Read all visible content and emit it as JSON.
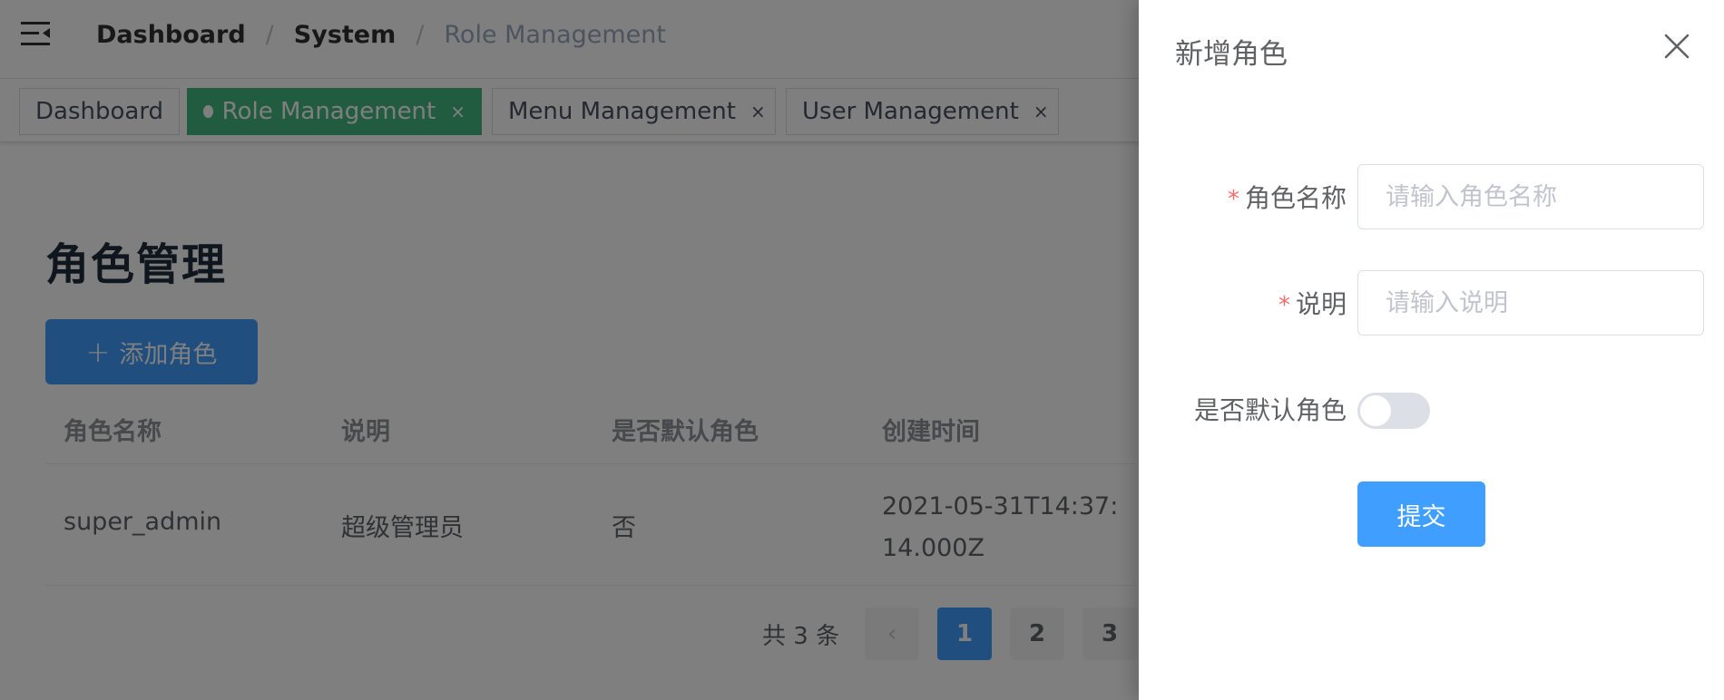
{
  "navbar": {
    "breadcrumb": [
      "Dashboard",
      "System",
      "Role Management"
    ],
    "separator": "/"
  },
  "tags": [
    {
      "label": "Dashboard",
      "active": false,
      "closable": false
    },
    {
      "label": "Role Management",
      "active": true,
      "closable": true
    },
    {
      "label": "Menu Management",
      "active": false,
      "closable": true
    },
    {
      "label": "User Management",
      "active": false,
      "closable": true
    }
  ],
  "tag_close_glyph": "×",
  "page": {
    "title": "角色管理",
    "add_button_label": "添加角色",
    "add_button_icon": "plus-icon"
  },
  "table": {
    "headers": [
      "角色名称",
      "说明",
      "是否默认角色",
      "创建时间"
    ],
    "rows": [
      [
        "super_admin",
        "超级管理员",
        "否",
        "2021-05-31T14:37:14.000Z"
      ]
    ]
  },
  "pagination": {
    "total_text": "共 3 条",
    "pages": [
      "1",
      "2",
      "3"
    ],
    "current_page": "1",
    "prev_glyph": "‹"
  },
  "drawer": {
    "title": "新增角色",
    "close_icon": "close-icon",
    "fields": {
      "name": {
        "label": "角色名称",
        "placeholder": "请输入角色名称",
        "value": "",
        "required": true
      },
      "description": {
        "label": "说明",
        "placeholder": "请输入说明",
        "value": "",
        "required": true
      },
      "is_default": {
        "label": "是否默认角色",
        "checked": false
      }
    },
    "required_mark": "*",
    "submit_label": "提交"
  },
  "colors": {
    "primary": "#409eff",
    "active_tag": "#42b983",
    "required": "#f56c6c",
    "overlay": "rgba(0,0,0,0.5)"
  }
}
